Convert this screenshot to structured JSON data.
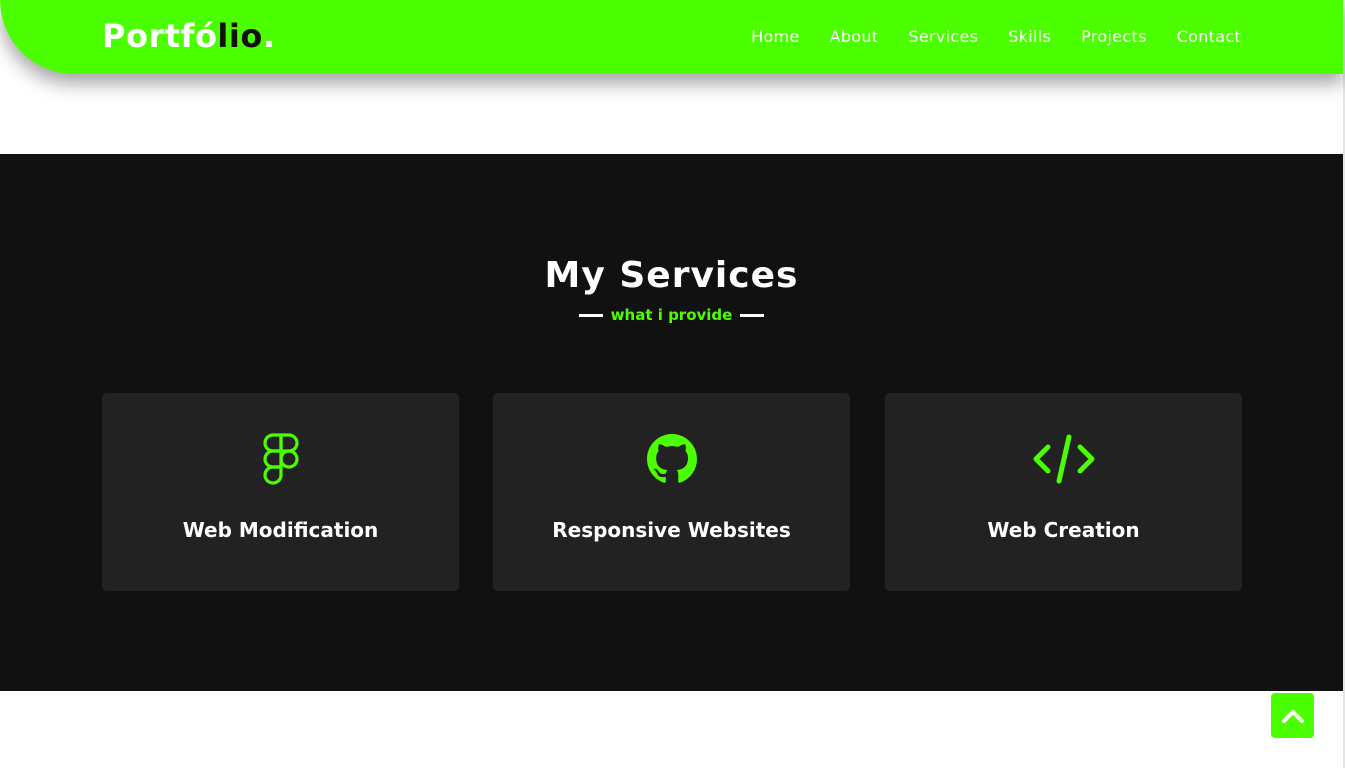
{
  "header": {
    "logo": {
      "part1": "Portfó",
      "part2": "lio",
      "dot": "."
    },
    "nav": [
      {
        "label": "Home"
      },
      {
        "label": "About"
      },
      {
        "label": "Services"
      },
      {
        "label": "Skills"
      },
      {
        "label": "Projects"
      },
      {
        "label": "Contact"
      }
    ]
  },
  "services": {
    "title": "My Services",
    "subtitle": "what i provide",
    "cards": [
      {
        "icon": "figma-icon",
        "title": "Web Modification"
      },
      {
        "icon": "github-icon",
        "title": "Responsive Websites"
      },
      {
        "icon": "code-icon",
        "title": "Web Creation"
      }
    ]
  },
  "back_to_top": {
    "icon": "chevron-up-icon"
  },
  "colors": {
    "accent": "#4cff00",
    "section_bg": "#111111",
    "card_bg": "#222222",
    "text": "#ffffff"
  }
}
